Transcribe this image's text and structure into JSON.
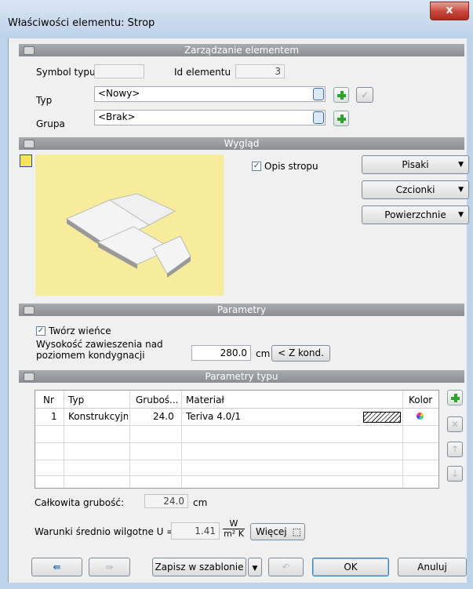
{
  "window": {
    "title": "Właściwości elementu: Strop",
    "close": "x"
  },
  "sections": {
    "management": "Zarządzanie elementem",
    "appearance": "Wygląd",
    "params": "Parametry",
    "type_params": "Parametry typu"
  },
  "management": {
    "symbol_label": "Symbol typu",
    "symbol_value": "",
    "id_label": "Id elementu",
    "id_value": "3",
    "type_label": "Typ",
    "type_value": "<Nowy>",
    "group_label": "Grupa",
    "group_value": "<Brak>"
  },
  "appearance": {
    "opis_label": "Opis stropu",
    "opis_checked": true,
    "buttons": [
      "Pisaki",
      "Czcionki",
      "Powierzchnie"
    ],
    "preview_bg": "#f6ec9c"
  },
  "params": {
    "wience_label": "Twórz wieńce",
    "wience_checked": true,
    "height_label_1": "Wysokość zawieszenia nad",
    "height_label_2": "poziomem kondygnacji",
    "height_value": "280.0",
    "height_unit": "cm",
    "zkond": "< Z kond."
  },
  "layers": {
    "columns": [
      "Nr",
      "Typ",
      "Gruboś...",
      "Materiał",
      "",
      "Kolor"
    ],
    "rows": [
      {
        "nr": "1",
        "typ": "Konstrukcyjna i",
        "thick": "24.0",
        "material": "Teriva 4.0/1"
      }
    ]
  },
  "totals": {
    "total_label": "Całkowita grubość:",
    "total_value": "24.0",
    "total_unit": "cm",
    "u_label": "Warunki średnio wilgotne U =",
    "u_value": "1.41",
    "u_num": "W",
    "u_den": "m² K",
    "more": "Więcej"
  },
  "footer": {
    "save_template": "Zapisz w szablonie",
    "ok": "OK",
    "cancel": "Anuluj"
  },
  "colors": {
    "accent_green": "#2aa52a",
    "section_bar": "#8a8d91",
    "preview": "#f6ec9c"
  }
}
